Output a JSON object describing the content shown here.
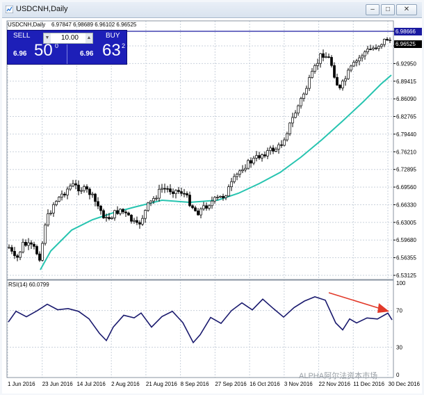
{
  "window": {
    "title": "USDCNH,Daily",
    "controls": [
      "minimize",
      "restore",
      "close"
    ]
  },
  "chart": {
    "header_symbol": "USDCNH,Daily",
    "header_ohlc": "6.97847 6.98689 6.96102 6.96525",
    "current_price": "6.96525",
    "line_price": "6.98666",
    "price_ticks": [
      "6.98666",
      "6.95525",
      "6.92950",
      "6.89415",
      "6.86090",
      "6.82765",
      "6.79440",
      "6.76210",
      "6.72895",
      "6.69560",
      "6.66330",
      "6.63005",
      "6.59680",
      "6.56355",
      "6.53125"
    ],
    "date_ticks": [
      "1 Jun 2016",
      "23 Jun 2016",
      "14 Jul 2016",
      "2 Aug 2016",
      "21 Aug 2016",
      "8 Sep 2016",
      "27 Sep 2016",
      "16 Oct 2016",
      "3 Nov 2016",
      "22 Nov 2016",
      "11 Dec 2016",
      "30 Dec 2016"
    ],
    "rsi_label": "RSI(14) 60.0799",
    "rsi_ticks": [
      "100",
      "70",
      "30",
      "0"
    ],
    "colors": {
      "candles": "#000000",
      "ma": "#27c4b0",
      "rsi": "#1a1a6e",
      "hline": "#1a1aa0",
      "arrow": "#e23a2a",
      "grid": "#c9d1db"
    }
  },
  "trade_panel": {
    "sell_label": "SELL",
    "buy_label": "BUY",
    "volume": "10.00",
    "sell_prefix": "6.96",
    "sell_big": "50",
    "sell_pip": "0",
    "buy_prefix": "6.96",
    "buy_big": "63",
    "buy_pip": "2"
  },
  "watermark": "ALPHA阿尔法资本市场"
}
